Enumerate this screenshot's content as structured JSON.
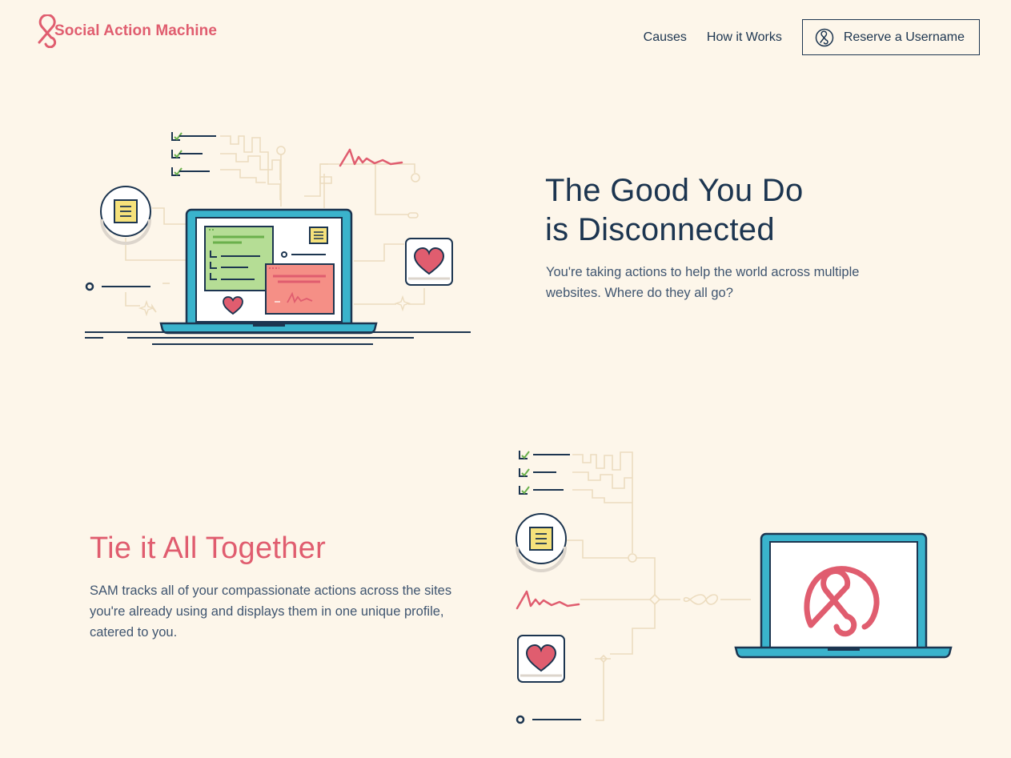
{
  "header": {
    "logo_text": "Social Action Machine",
    "nav": {
      "causes": "Causes",
      "how_it_works": "How it Works",
      "reserve": "Reserve a Username"
    }
  },
  "section1": {
    "title_line1": "The Good You Do",
    "title_line2": "is Disconnected",
    "body": "You're taking actions to help the world across multiple websites. Where do they all go?"
  },
  "section2": {
    "title": "Tie it All Together",
    "body": "SAM tracks all of your compassionate actions across the sites you're already using and displays them in one unique profile, catered to you."
  },
  "colors": {
    "background": "#fdf6ea",
    "navy": "#1c3550",
    "brand_red": "#e05d6f",
    "teal": "#3ab3cc",
    "green": "#b5dd95",
    "salmon": "#f58f86",
    "yellow": "#f6e27b",
    "line_beige": "#ecdcbf"
  },
  "icons": [
    "sam-logo-icon",
    "user-icon",
    "checkbox-icon",
    "note-icon",
    "heart-icon",
    "signature-icon",
    "laptop-icon",
    "infinity-icon"
  ]
}
